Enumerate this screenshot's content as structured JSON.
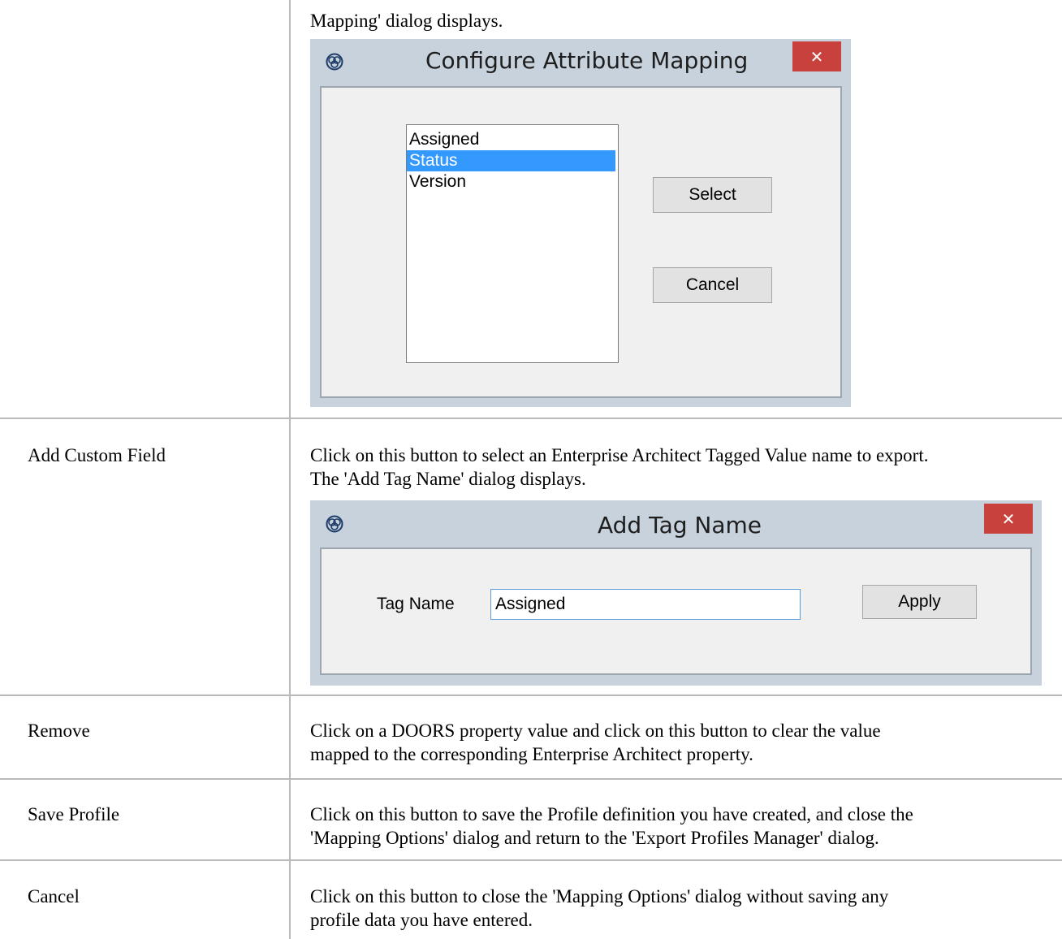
{
  "table": {
    "rows": [
      {
        "label": "",
        "description_lines": [
          "Mapping' dialog displays."
        ]
      },
      {
        "label": "Add Custom Field",
        "description_lines": [
          "Click on this button to select an Enterprise Architect Tagged Value name to export.",
          "The 'Add Tag Name' dialog displays."
        ]
      },
      {
        "label": "Remove",
        "description_lines": [
          "Click on a DOORS property value and click on this button to clear the value",
          "mapped to the corresponding Enterprise Architect property."
        ]
      },
      {
        "label": "Save Profile",
        "description_lines": [
          "Click on this button to save the Profile definition you have created, and close the",
          "'Mapping Options' dialog and return to the 'Export Profiles Manager' dialog."
        ]
      },
      {
        "label": "Cancel",
        "description_lines": [
          "Click on this button to close the 'Mapping Options' dialog without saving any",
          "profile data you have entered."
        ]
      }
    ]
  },
  "attribute_dialog": {
    "title": "Configure Attribute Mapping",
    "close_glyph": "✕",
    "icon": "app-logo-icon",
    "list_items": [
      "Assigned",
      "Status",
      "Version"
    ],
    "selected_item": "Status",
    "select_label": "Select",
    "cancel_label": "Cancel"
  },
  "tag_dialog": {
    "title": "Add Tag Name",
    "close_glyph": "✕",
    "icon": "app-logo-icon",
    "field_label": "Tag Name",
    "field_value": "Assigned",
    "apply_label": "Apply"
  },
  "colors": {
    "dialog_frame": "#c7d2dd",
    "close_button": "#c9413c",
    "selection": "#3399ff",
    "grid_line": "#b9b9b9"
  }
}
